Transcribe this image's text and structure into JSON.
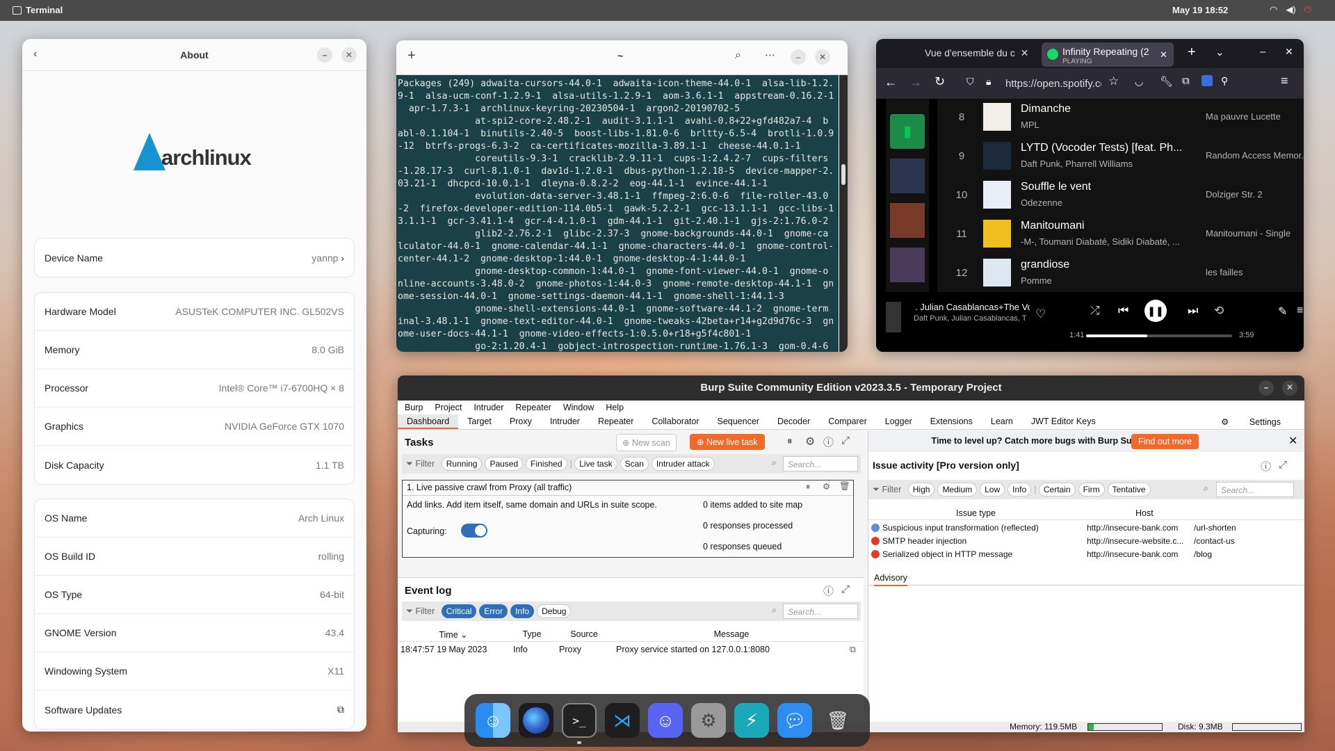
{
  "topbar": {
    "app": "Terminal",
    "clock": "May 19  18:52"
  },
  "about": {
    "title": "About",
    "logo_text": "archlinux",
    "device": {
      "label": "Device Name",
      "value": "yannp"
    },
    "hardware": [
      {
        "label": "Hardware Model",
        "value": "ASUSTeK COMPUTER INC. GL502VS"
      },
      {
        "label": "Memory",
        "value": "8.0 GiB"
      },
      {
        "label": "Processor",
        "value": "Intel® Core™ i7-6700HQ × 8"
      },
      {
        "label": "Graphics",
        "value": "NVIDIA GeForce GTX 1070"
      },
      {
        "label": "Disk Capacity",
        "value": "1.1 TB"
      }
    ],
    "os": [
      {
        "label": "OS Name",
        "value": "Arch Linux"
      },
      {
        "label": "OS Build ID",
        "value": "rolling"
      },
      {
        "label": "OS Type",
        "value": "64-bit"
      },
      {
        "label": "GNOME Version",
        "value": "43.4"
      },
      {
        "label": "Windowing System",
        "value": "X11"
      },
      {
        "label": "Software Updates",
        "value": ""
      }
    ]
  },
  "terminal": {
    "title": "~",
    "output": "Packages (249) adwaita-cursors-44.0-1  adwaita-icon-theme-44.0-1  alsa-lib-1.2.\n9-1  alsa-ucm-conf-1.2.9-1  alsa-utils-1.2.9-1  aom-3.6.1-1  appstream-0.16.2-1\n  apr-1.7.3-1  archlinux-keyring-20230504-1  argon2-20190702-5\n              at-spi2-core-2.48.2-1  audit-3.1.1-1  avahi-0.8+22+gfd482a7-4  b\nabl-0.1.104-1  binutils-2.40-5  boost-libs-1.81.0-6  brltty-6.5-4  brotli-1.0.9\n-12  btrfs-progs-6.3-2  ca-certificates-mozilla-3.89.1-1  cheese-44.0.1-1\n              coreutils-9.3-1  cracklib-2.9.11-1  cups-1:2.4.2-7  cups-filters\n-1.28.17-3  curl-8.1.0-1  dav1d-1.2.0-1  dbus-python-1.2.18-5  device-mapper-2.\n03.21-1  dhcpcd-10.0.1-1  dleyna-0.8.2-2  eog-44.1-1  evince-44.1-1\n              evolution-data-server-3.48.1-1  ffmpeg-2:6.0-6  file-roller-43.0\n-2  firefox-developer-edition-114.0b5-1  gawk-5.2.2-1  gcc-13.1.1-1  gcc-libs-1\n3.1.1-1  gcr-3.41.1-4  gcr-4-4.1.0-1  gdm-44.1-1  git-2.40.1-1  gjs-2:1.76.0-2\n              glib2-2.76.2-1  glibc-2.37-3  gnome-backgrounds-44.0-1  gnome-ca\nlculator-44.0-1  gnome-calendar-44.1-1  gnome-characters-44.0-1  gnome-control-\ncenter-44.1-2  gnome-desktop-1:44.0-1  gnome-desktop-4-1:44.0-1\n              gnome-desktop-common-1:44.0-1  gnome-font-viewer-44.0-1  gnome-o\nnline-accounts-3.48.0-2  gnome-photos-1:44.0-3  gnome-remote-desktop-44.1-1  gn\nome-session-44.0-1  gnome-settings-daemon-44.1-1  gnome-shell-1:44.1-3\n              gnome-shell-extensions-44.0-1  gnome-software-44.1-2  gnome-term\ninal-3.48.1-1  gnome-text-editor-44.0-1  gnome-tweaks-42beta+r14+g2d9d76c-3  gn\nome-user-docs-44.1-1  gnome-video-effects-1:0.5.0+r18+g5f4c801-1\n              go-2:1.20.4-1  gobject-introspection-runtime-1.76.1-3  gom-0.4-6"
  },
  "browser": {
    "tab1": "Vue d'ensemble du c",
    "tab2_title": "Infinity Repeating (2",
    "tab2_status": "PLAYING",
    "url": "https://open.spotify.com/",
    "tracks": [
      {
        "n": "8",
        "title": "Dimanche",
        "artist": "MPL",
        "album": "Ma pauvre Lucette"
      },
      {
        "n": "9",
        "title": "LYTD (Vocoder Tests) [feat. Ph...",
        "artist": "Daft Punk, Pharrell Williams",
        "album": "Random Access Memor..."
      },
      {
        "n": "10",
        "title": "Souffle le vent",
        "artist": "Odezenne",
        "album": "Dolziger Str. 2"
      },
      {
        "n": "11",
        "title": "Manitoumani",
        "artist": "-M-, Toumani Diabaté, Sidiki Diabaté, ...",
        "album": "Manitoumani - Single"
      },
      {
        "n": "12",
        "title": "grandiose",
        "artist": "Pomme",
        "album": "les failles"
      }
    ],
    "now_playing": {
      "title": ". Julian Casablancas+The Vo",
      "artist": "Daft Punk, Julian Casablancas, T",
      "elapsed": "1:41",
      "total": "3:59",
      "progress": 0.42
    }
  },
  "burp": {
    "title": "Burp Suite Community Edition v2023.3.5 - Temporary Project",
    "menu": [
      "Burp",
      "Project",
      "Intruder",
      "Repeater",
      "Window",
      "Help"
    ],
    "tabs": [
      "Dashboard",
      "Target",
      "Proxy",
      "Intruder",
      "Repeater",
      "Collaborator",
      "Sequencer",
      "Decoder",
      "Comparer",
      "Logger",
      "Extensions",
      "Learn",
      "JWT Editor Keys"
    ],
    "settings": "Settings",
    "tasks": {
      "heading": "Tasks",
      "new_scan": "New scan",
      "new_live_task": "New live task",
      "filter": "Filter",
      "filters": [
        "Running",
        "Paused",
        "Finished",
        "Live task",
        "Scan",
        "Intruder attack"
      ],
      "search": "Search...",
      "task_title": "1. Live passive crawl from Proxy (all traffic)",
      "task_desc": "Add links. Add item itself, same domain and URLs in suite scope.",
      "capturing": "Capturing:",
      "stats": [
        "0 items added to site map",
        "0 responses processed",
        "0 responses queued"
      ]
    },
    "eventlog": {
      "heading": "Event log",
      "filters": [
        "Critical",
        "Error",
        "Info",
        "Debug"
      ],
      "cols": [
        "Time",
        "Type",
        "Source",
        "Message"
      ],
      "row": {
        "time": "18:47:57 19 May 2023",
        "type": "Info",
        "source": "Proxy",
        "message": "Proxy service started on 127.0.0.1:8080"
      }
    },
    "promo": {
      "text": "Time to level up? Catch more bugs with Burp Suite Pro",
      "button": "Find out more"
    },
    "issues": {
      "heading": "Issue activity [Pro version only]",
      "filters": [
        "High",
        "Medium",
        "Low",
        "Info",
        "Certain",
        "Firm",
        "Tentative"
      ],
      "cols": [
        "Issue type",
        "Host"
      ],
      "rows": [
        {
          "type": "Suspicious input transformation (reflected)",
          "host": "http://insecure-bank.com",
          "path": "/url-shorten"
        },
        {
          "type": "SMTP header injection",
          "host": "http://insecure-website.c...",
          "path": "/contact-us"
        },
        {
          "type": "Serialized object in HTTP message",
          "host": "http://insecure-bank.com",
          "path": "/blog"
        }
      ],
      "advisory": "Advisory"
    },
    "status": {
      "memory": "Memory: 119.5MB",
      "disk": "Disk: 9.3MB"
    }
  }
}
